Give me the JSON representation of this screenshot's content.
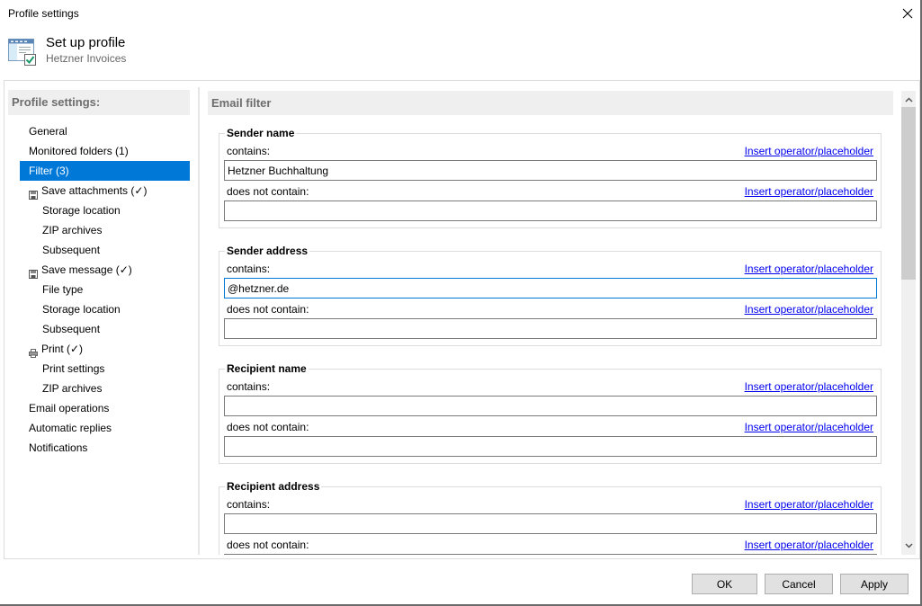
{
  "window": {
    "title": "Profile settings",
    "close_icon": "close-icon"
  },
  "header": {
    "title": "Set up profile",
    "subtitle": "Hetzner Invoices",
    "icon": "profile-settings-icon"
  },
  "sidebar": {
    "header": "Profile settings:",
    "items": [
      {
        "label": "General",
        "level": 0,
        "selected": false
      },
      {
        "label": "Monitored folders (1)",
        "level": 0,
        "selected": false
      },
      {
        "label": "Filter (3)",
        "level": 0,
        "selected": true
      },
      {
        "label": "Save attachments (✓)",
        "level": 0,
        "selected": false,
        "icon": "save-icon"
      },
      {
        "label": "Storage location",
        "level": 1,
        "selected": false
      },
      {
        "label": "ZIP archives",
        "level": 1,
        "selected": false
      },
      {
        "label": "Subsequent",
        "level": 1,
        "selected": false
      },
      {
        "label": "Save message (✓)",
        "level": 0,
        "selected": false,
        "icon": "save-icon"
      },
      {
        "label": "File type",
        "level": 1,
        "selected": false
      },
      {
        "label": "Storage location",
        "level": 1,
        "selected": false
      },
      {
        "label": "Subsequent",
        "level": 1,
        "selected": false
      },
      {
        "label": "Print  (✓)",
        "level": 0,
        "selected": false,
        "icon": "printer-icon"
      },
      {
        "label": "Print settings",
        "level": 1,
        "selected": false
      },
      {
        "label": "ZIP archives",
        "level": 1,
        "selected": false
      },
      {
        "label": "Email operations",
        "level": 0,
        "selected": false
      },
      {
        "label": "Automatic replies",
        "level": 0,
        "selected": false
      },
      {
        "label": "Notifications",
        "level": 0,
        "selected": false
      }
    ]
  },
  "main": {
    "header": "Email filter",
    "insert_link": "Insert operator/placeholder",
    "groups": [
      {
        "title": "Sender name",
        "contains_label": "contains:",
        "contains_value": "Hetzner Buchhaltung",
        "not_contains_label": "does not contain:",
        "not_contains_value": ""
      },
      {
        "title": "Sender address",
        "contains_label": "contains:",
        "contains_value": "@hetzner.de",
        "not_contains_label": "does not contain:",
        "not_contains_value": ""
      },
      {
        "title": "Recipient name",
        "contains_label": "contains:",
        "contains_value": "",
        "not_contains_label": "does not contain:",
        "not_contains_value": ""
      },
      {
        "title": "Recipient address",
        "contains_label": "contains:",
        "contains_value": "",
        "not_contains_label": "does not contain:",
        "not_contains_value": ""
      }
    ],
    "scroll": {
      "position_fraction": 0.0,
      "visible_fraction": 0.4
    }
  },
  "buttons": {
    "ok": "OK",
    "cancel": "Cancel",
    "apply": "Apply"
  },
  "colors": {
    "accent": "#0078d7",
    "link": "#0000ee",
    "panel_header_bg": "#efefef",
    "panel_header_text": "#6d6d6d"
  }
}
